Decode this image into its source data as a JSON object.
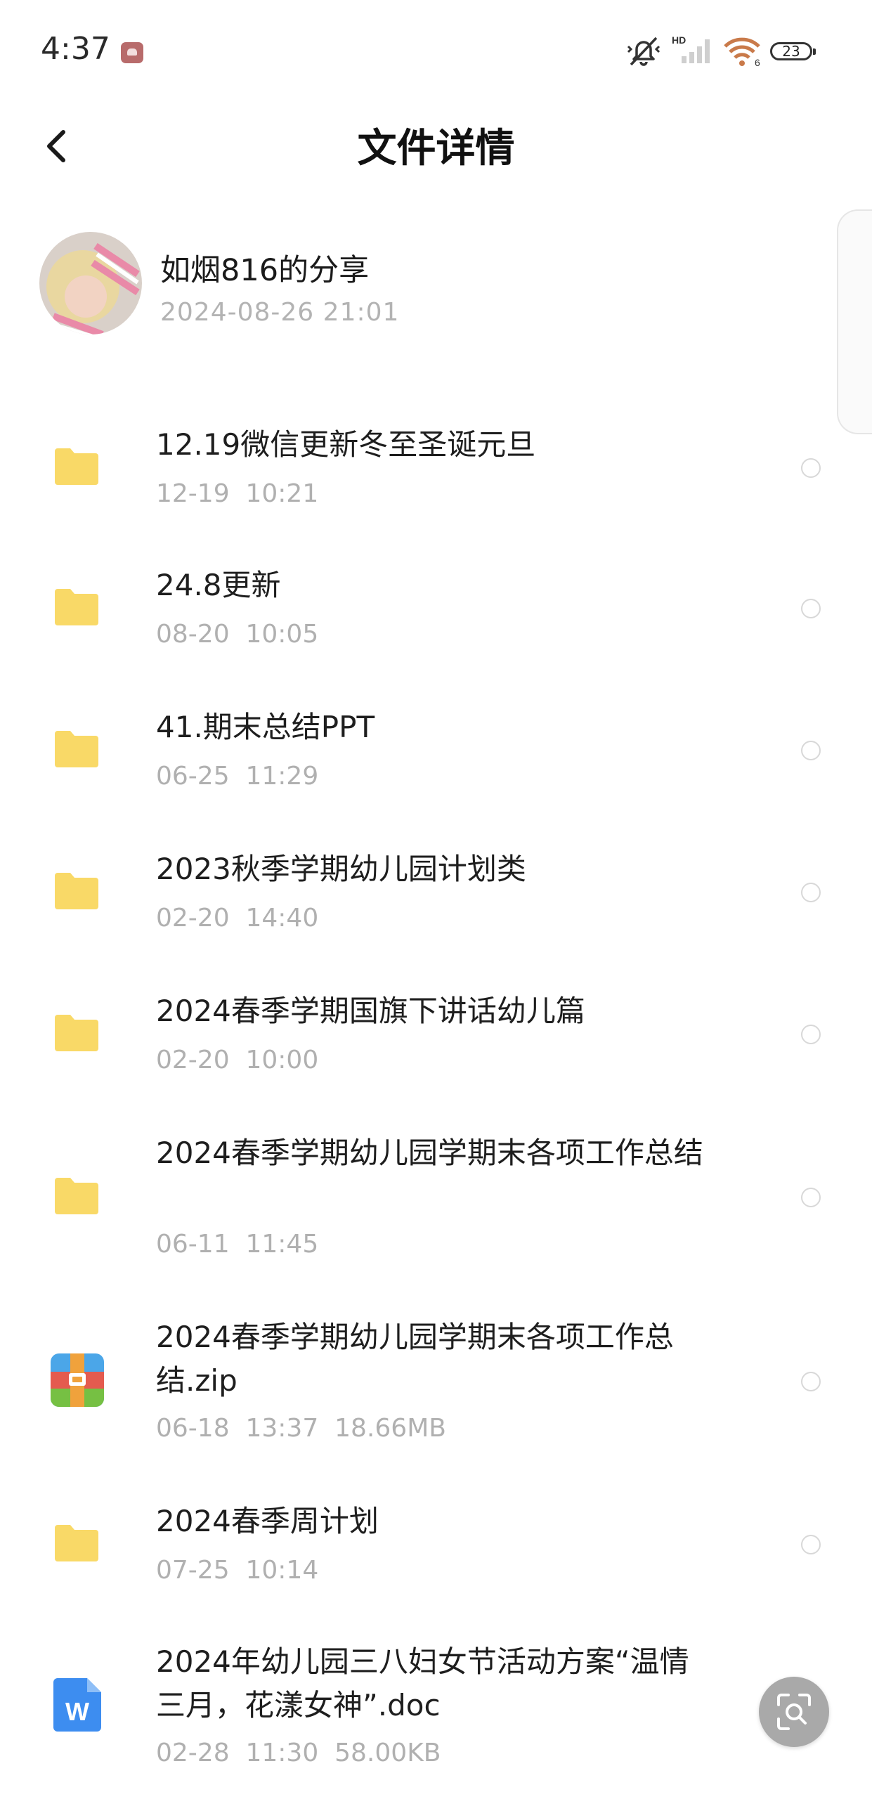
{
  "status_bar": {
    "time": "4:37",
    "signal_label": "HD",
    "wifi_label": "6",
    "battery": "23"
  },
  "header": {
    "title": "文件详情"
  },
  "sharer": {
    "name": "如烟816的分享",
    "time": "2024-08-26  21:01"
  },
  "files": [
    {
      "name": "12.19微信更新冬至圣诞元旦",
      "meta": "12-19  10:21",
      "type": "folder"
    },
    {
      "name": "24.8更新",
      "meta": "08-20  10:05",
      "type": "folder"
    },
    {
      "name": "41.期末总结PPT",
      "meta": "06-25  11:29",
      "type": "folder"
    },
    {
      "name": "2023秋季学期幼儿园计划类",
      "meta": "02-20  14:40",
      "type": "folder"
    },
    {
      "name": "2024春季学期国旗下讲话幼儿篇",
      "meta": "02-20  10:00",
      "type": "folder"
    },
    {
      "name": "2024春季学期幼儿园学期末各项工作总结",
      "meta": "06-11  11:45",
      "type": "folder"
    },
    {
      "name": "2024春季学期幼儿园学期末各项工作总结.zip",
      "meta": "06-18  13:37  18.66MB",
      "type": "zip"
    },
    {
      "name": "2024春季周计划",
      "meta": "07-25  10:14",
      "type": "folder"
    },
    {
      "name": "2024年幼儿园三八妇女节活动方案“温情三月，花漾女神”.doc",
      "meta": "02-28  11:30  58.00KB",
      "type": "doc"
    }
  ],
  "colors": {
    "folder": "#F9D967",
    "zip_red": "#E45B4F",
    "zip_blue": "#4BA6E8",
    "zip_green": "#76C043",
    "zip_orange": "#F0A23C",
    "doc_blue": "#3D8DF0",
    "meta_gray": "#B0B0B0"
  },
  "icons": {
    "back": "chevron-left-icon",
    "folder": "folder-icon",
    "zip": "zip-archive-icon",
    "doc": "word-document-icon",
    "scan": "scan-search-icon"
  }
}
